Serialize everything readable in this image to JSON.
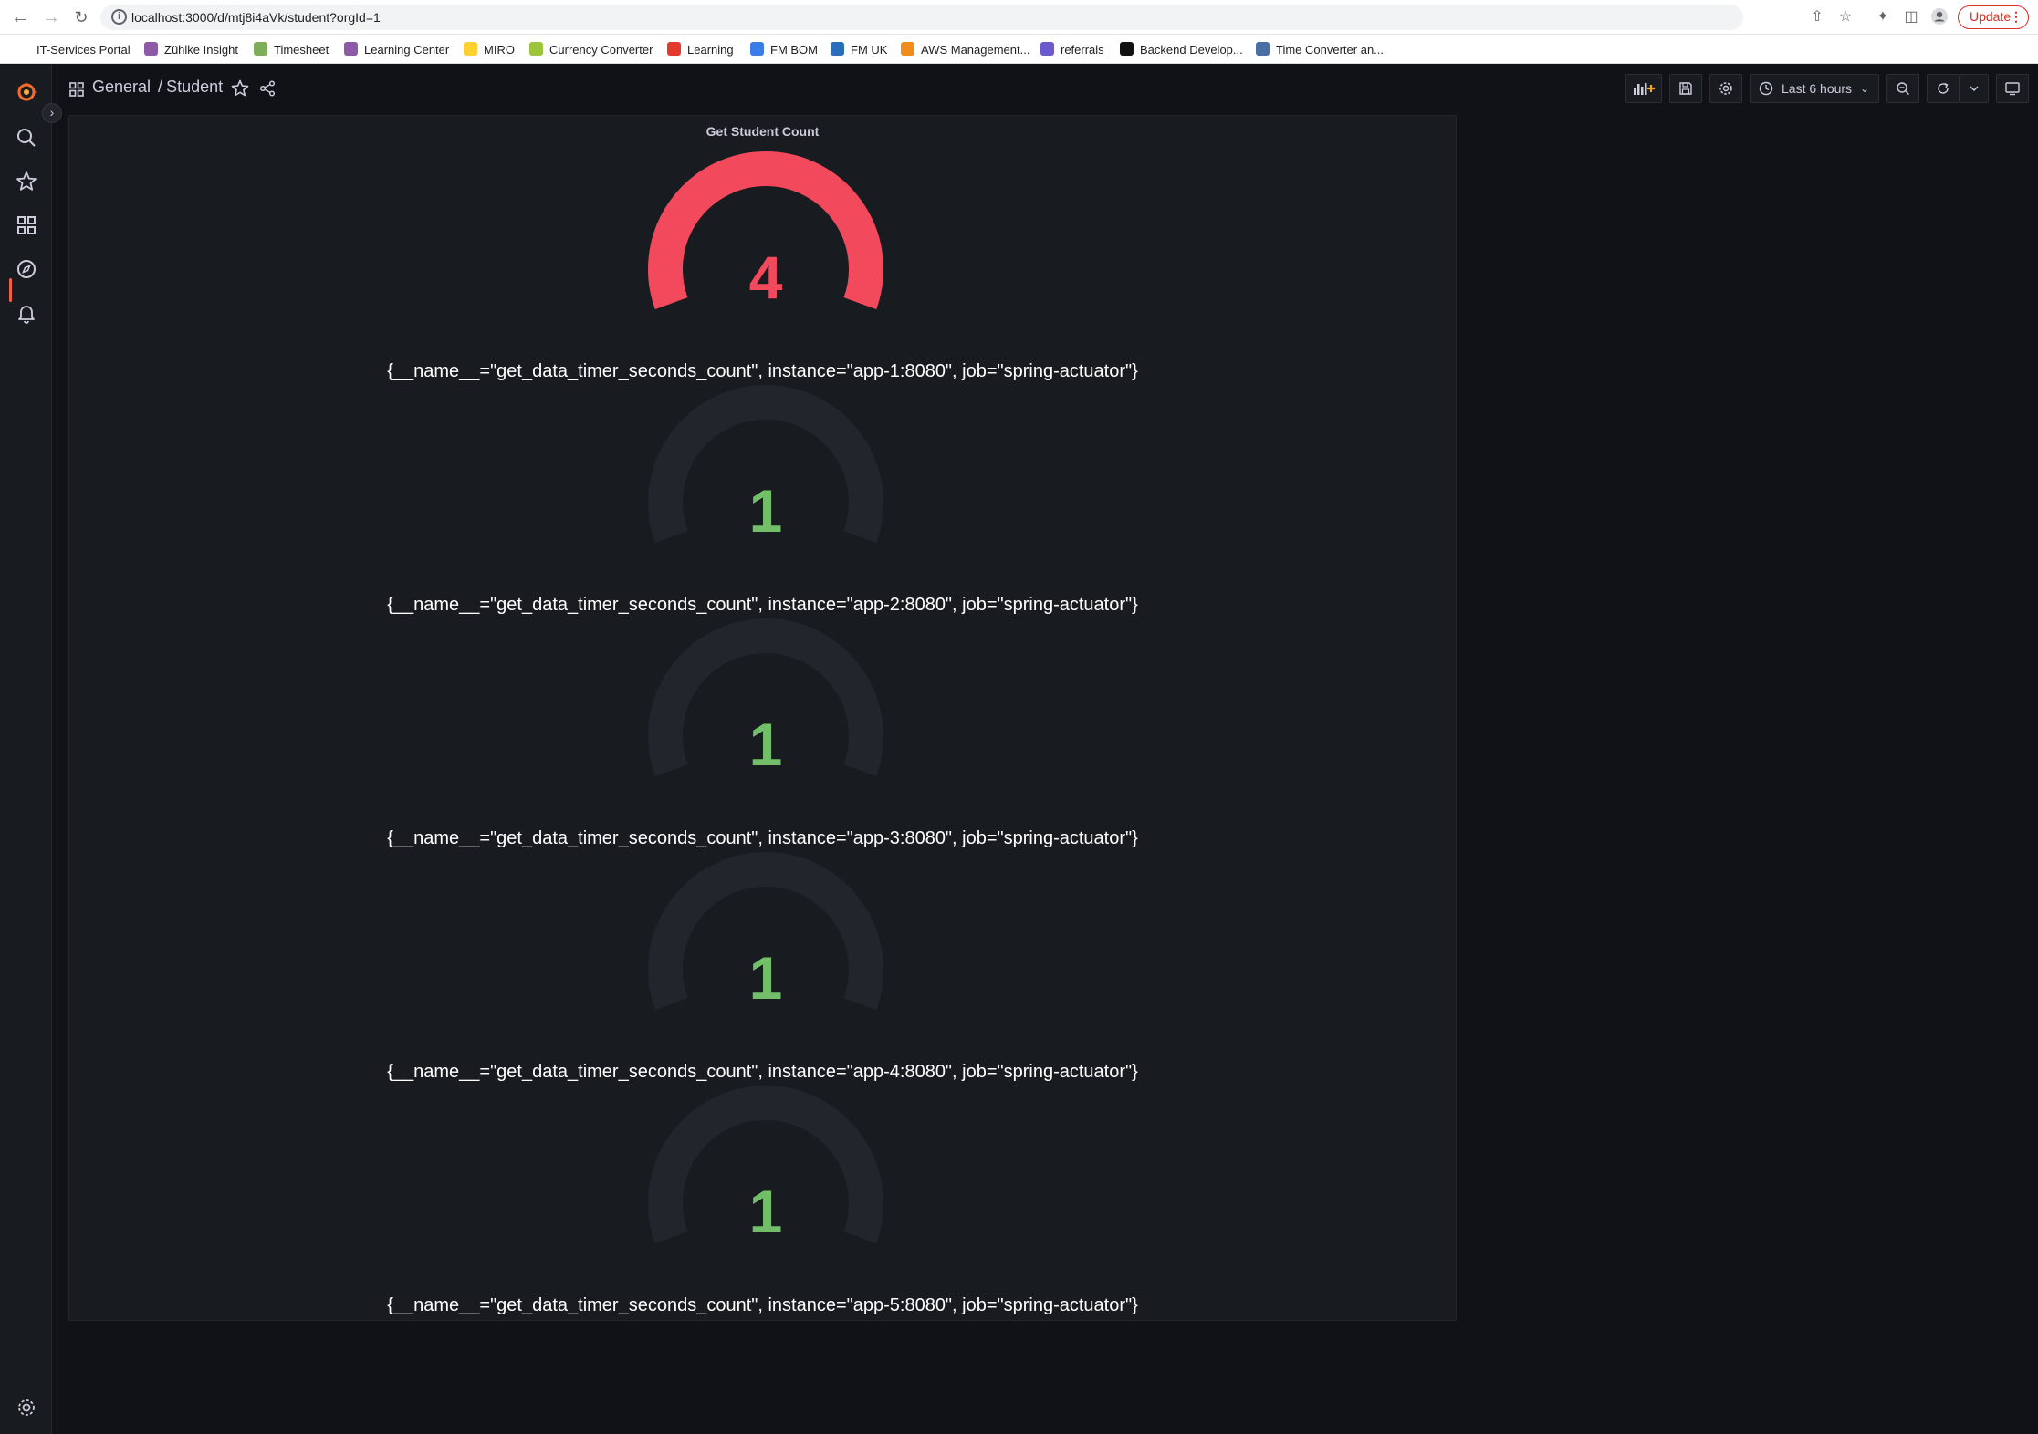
{
  "browser": {
    "url": "localhost:3000/d/mtj8i4aVk/student?orgId=1",
    "update_label": "Update"
  },
  "bookmarks": [
    {
      "label": "IT-Services Portal",
      "color": "#ffffff"
    },
    {
      "label": "Zühlke Insight",
      "color": "#8e5aa8"
    },
    {
      "label": "Timesheet",
      "color": "#7fae5a"
    },
    {
      "label": "Learning Center",
      "color": "#8e5aa8"
    },
    {
      "label": "MIRO",
      "color": "#ffd02f"
    },
    {
      "label": "Currency Converter",
      "color": "#9bc53d"
    },
    {
      "label": "Learning",
      "color": "#e23b2e"
    },
    {
      "label": "FM BOM",
      "color": "#3b7de8"
    },
    {
      "label": "FM UK",
      "color": "#2a6ebb"
    },
    {
      "label": "AWS Management...",
      "color": "#f08c1a"
    },
    {
      "label": "referrals",
      "color": "#6a5acd"
    },
    {
      "label": "Backend Develop...",
      "color": "#111111"
    },
    {
      "label": "Time Converter an...",
      "color": "#4a6fa5"
    }
  ],
  "breadcrumb": {
    "folder": "General",
    "separator": "/",
    "dashboard": "Student"
  },
  "toolbar": {
    "time_range": "Last 6 hours"
  },
  "panel": {
    "title": "Get Student Count",
    "gauges": [
      {
        "value": "4",
        "fraction": 1.0,
        "color": "#f2495c",
        "label": "{__name__=\"get_data_timer_seconds_count\", instance=\"app-1:8080\", job=\"spring-actuator\"}"
      },
      {
        "value": "1",
        "fraction": 0.0,
        "color": "#73bf69",
        "label": "{__name__=\"get_data_timer_seconds_count\", instance=\"app-2:8080\", job=\"spring-actuator\"}"
      },
      {
        "value": "1",
        "fraction": 0.0,
        "color": "#73bf69",
        "label": "{__name__=\"get_data_timer_seconds_count\", instance=\"app-3:8080\", job=\"spring-actuator\"}"
      },
      {
        "value": "1",
        "fraction": 0.0,
        "color": "#73bf69",
        "label": "{__name__=\"get_data_timer_seconds_count\", instance=\"app-4:8080\", job=\"spring-actuator\"}"
      },
      {
        "value": "1",
        "fraction": 0.0,
        "color": "#73bf69",
        "label": "{__name__=\"get_data_timer_seconds_count\", instance=\"app-5:8080\", job=\"spring-actuator\"}"
      }
    ]
  },
  "theme": {
    "track_color": "#22252b",
    "accent": "#f55f3e"
  }
}
